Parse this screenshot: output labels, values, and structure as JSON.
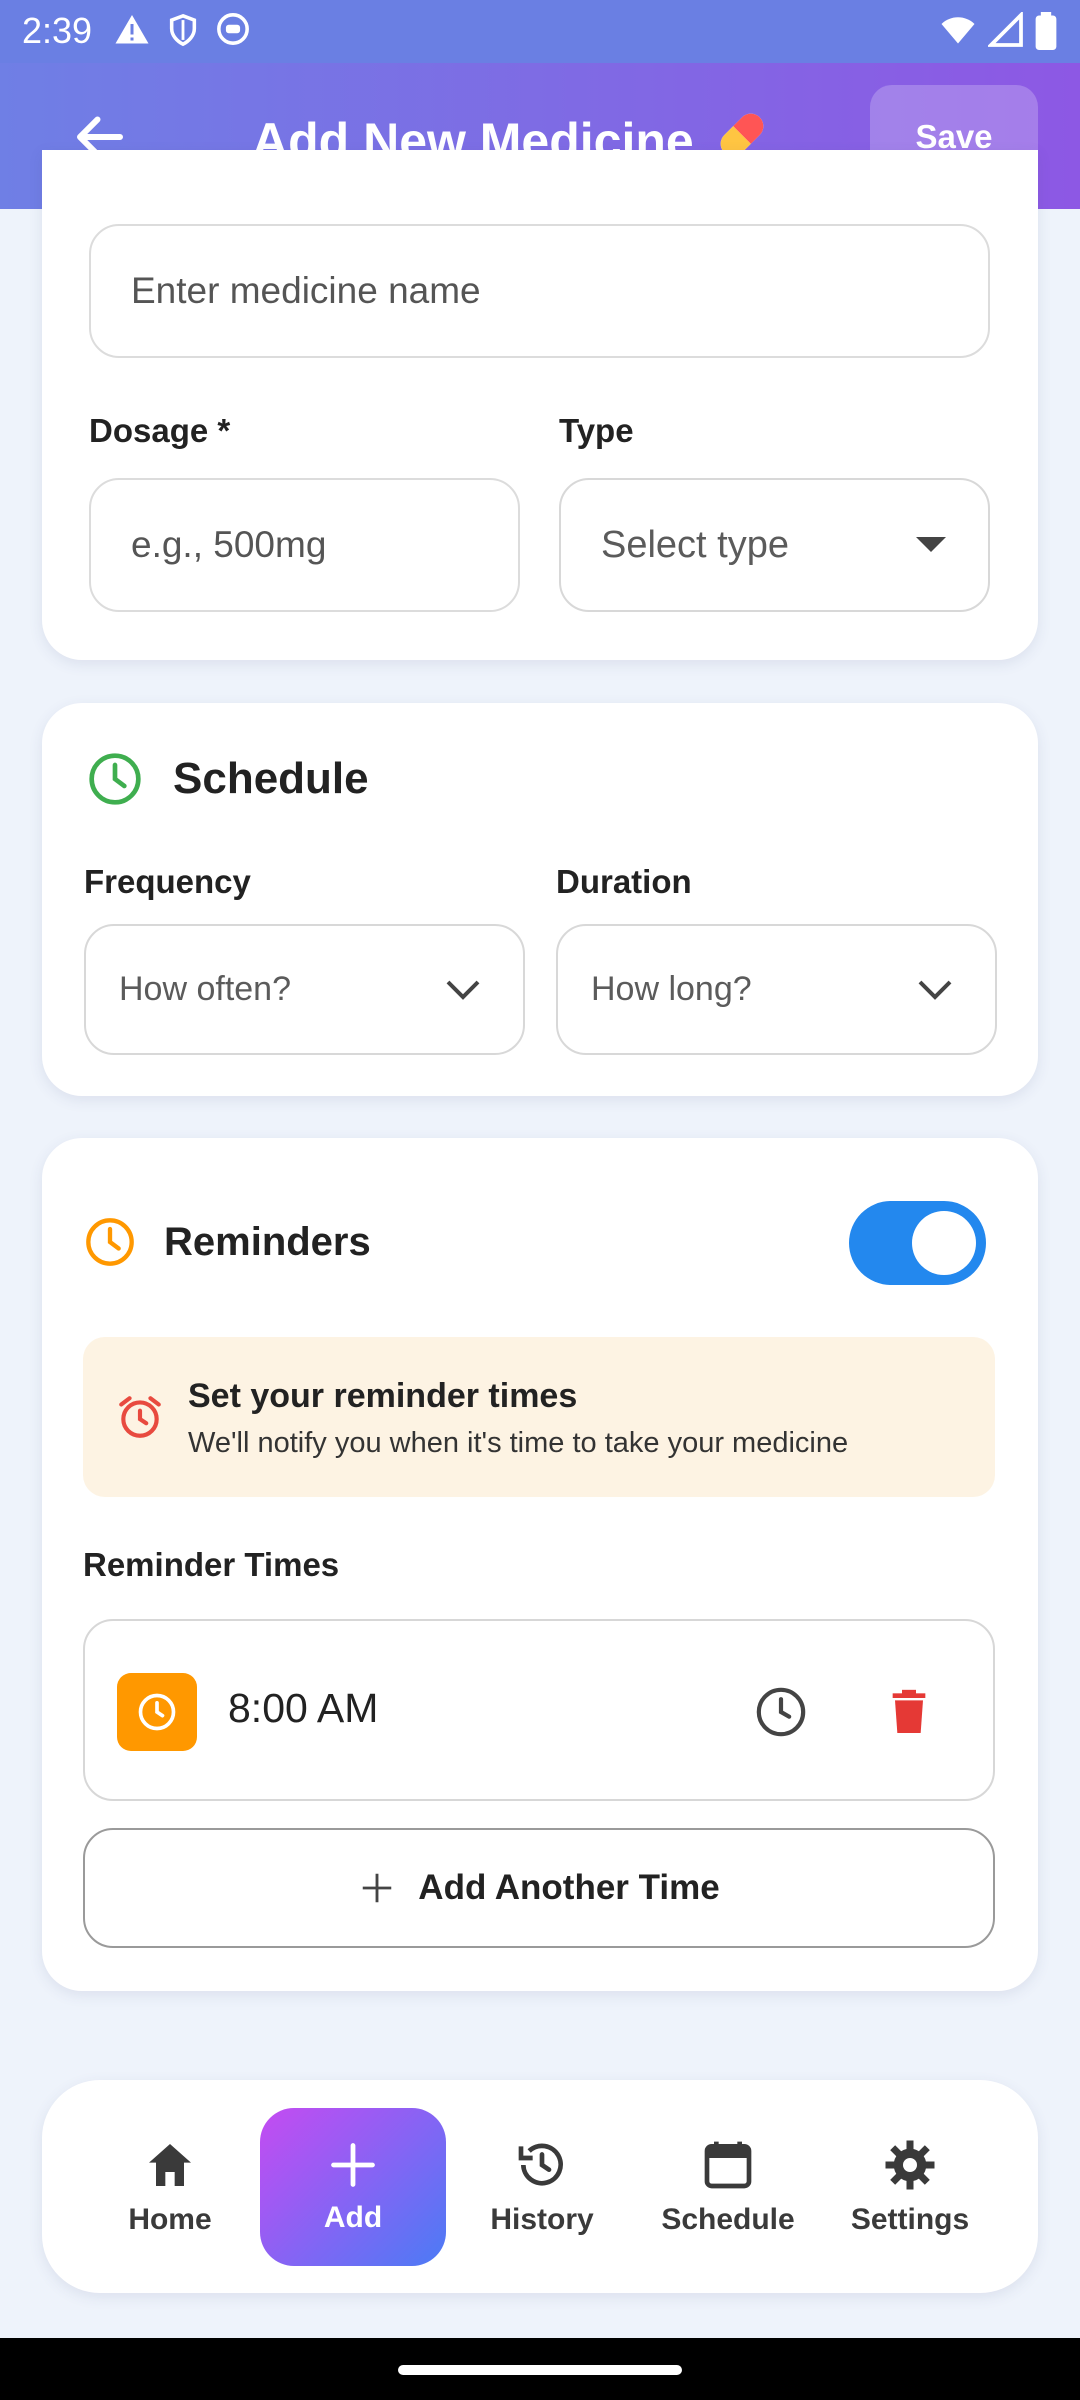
{
  "status_bar": {
    "time": "2:39"
  },
  "app_bar": {
    "title": "Add New Medicine",
    "title_emoji": "💊",
    "save_label": "Save"
  },
  "basic_info": {
    "name_placeholder": "Enter medicine name",
    "dosage_label": "Dosage *",
    "dosage_placeholder": "e.g., 500mg",
    "type_label": "Type",
    "type_placeholder": "Select type"
  },
  "schedule": {
    "title": "Schedule",
    "frequency_label": "Frequency",
    "frequency_placeholder": "How often?",
    "duration_label": "Duration",
    "duration_placeholder": "How long?",
    "accent": "#3fae4f"
  },
  "reminders": {
    "title": "Reminders",
    "enabled": true,
    "accent": "#ff9800",
    "info_title": "Set your reminder times",
    "info_text": "We'll notify you when it's time to take your medicine",
    "times_label": "Reminder Times",
    "times": [
      "8:00 AM"
    ],
    "add_label": "Add Another Time"
  },
  "bottom_nav": {
    "items": [
      {
        "label": "Home",
        "icon": "home-icon"
      },
      {
        "label": "Add",
        "icon": "plus-icon",
        "active": true
      },
      {
        "label": "History",
        "icon": "history-icon"
      },
      {
        "label": "Schedule",
        "icon": "calendar-icon"
      },
      {
        "label": "Settings",
        "icon": "gear-icon"
      }
    ]
  }
}
